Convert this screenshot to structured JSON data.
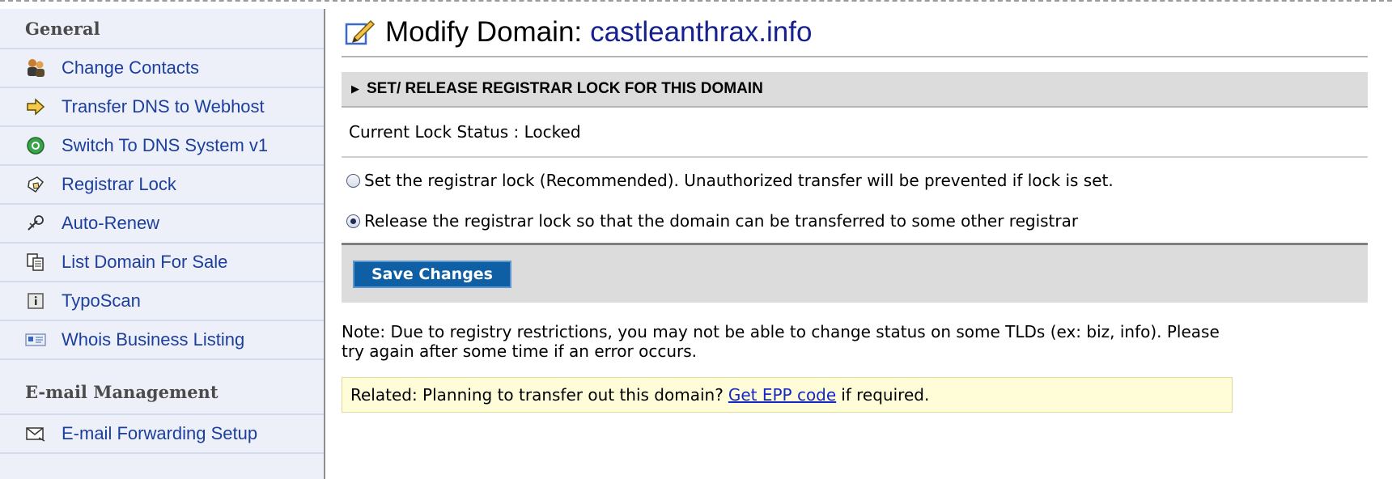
{
  "sidebar": {
    "sections": [
      {
        "title": "General",
        "items": [
          {
            "label": "Change Contacts",
            "icon": "people-icon"
          },
          {
            "label": "Transfer DNS to Webhost",
            "icon": "arrow-right-icon"
          },
          {
            "label": "Switch To DNS System v1",
            "icon": "green-switch-icon"
          },
          {
            "label": "Registrar Lock",
            "icon": "lock-icon"
          },
          {
            "label": "Auto-Renew",
            "icon": "auto-renew-icon"
          },
          {
            "label": "List Domain For Sale",
            "icon": "documents-icon"
          },
          {
            "label": "TypoScan",
            "icon": "info-box-icon"
          },
          {
            "label": "Whois Business Listing",
            "icon": "business-card-icon"
          }
        ]
      },
      {
        "title": "E-mail Management",
        "items": [
          {
            "label": "E-mail Forwarding Setup",
            "icon": "envelope-icon"
          }
        ]
      }
    ]
  },
  "main": {
    "title_prefix": "Modify Domain:",
    "domain": "castleanthrax.info",
    "section_header": "SET/ RELEASE REGISTRAR LOCK FOR THIS DOMAIN",
    "status_text": "Current Lock Status : Locked",
    "options": [
      {
        "label": "Set the registrar lock (Recommended). Unauthorized transfer will be prevented if lock is set.",
        "selected": false
      },
      {
        "label": "Release the registrar lock so that the domain can be transferred to some other registrar",
        "selected": true
      }
    ],
    "save_label": "Save Changes",
    "note": "Note: Due to registry restrictions, you may not be able to change status on some TLDs (ex: biz, info). Please try again after some time if an error occurs.",
    "related_prefix": "Related: Planning to transfer out this domain?",
    "related_link": "Get EPP code",
    "related_suffix": "if required."
  },
  "colors": {
    "sidebar_bg": "#eef0f9",
    "link": "#1c3f9e",
    "domain_title": "#16218f",
    "save_button": "#0f5fa5",
    "related_bg": "#fefdd8"
  }
}
